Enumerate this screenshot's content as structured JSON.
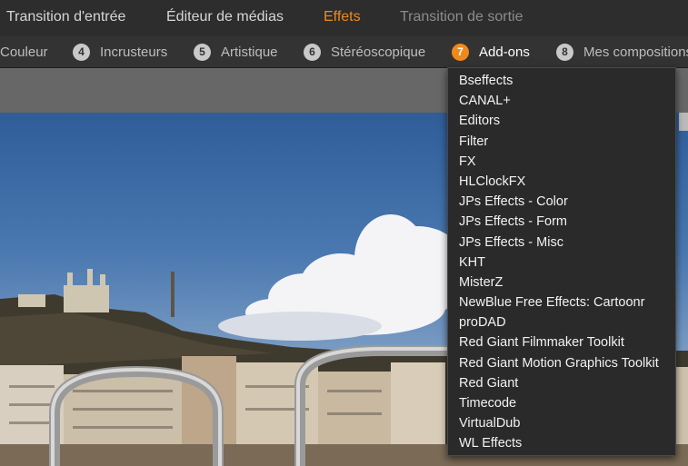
{
  "tabs": [
    {
      "label": "Transition d'entrée",
      "state": "normal"
    },
    {
      "label": "Éditeur de médias",
      "state": "normal"
    },
    {
      "label": "Effets",
      "state": "active"
    },
    {
      "label": "Transition de sortie",
      "state": "dim"
    }
  ],
  "categories": [
    {
      "num": "",
      "label": "Couleur"
    },
    {
      "num": "4",
      "label": "Incrusteurs"
    },
    {
      "num": "5",
      "label": "Artistique"
    },
    {
      "num": "6",
      "label": "Stéréoscopique"
    },
    {
      "num": "7",
      "label": "Add-ons"
    },
    {
      "num": "8",
      "label": "Mes compositions"
    }
  ],
  "addons_menu": {
    "items": [
      "Bseffects",
      "CANAL+",
      "Editors",
      "Filter",
      "FX",
      "HLClockFX",
      "JPs Effects - Color",
      "JPs Effects - Form",
      "JPs Effects - Misc",
      "KHT",
      "MisterZ",
      "NewBlue Free Effects: Cartoonr",
      "proDAD",
      "Red Giant Filmmaker Toolkit",
      "Red Giant Motion Graphics Toolkit",
      "Red Giant",
      "Timecode",
      "VirtualDub",
      "WL Effects"
    ]
  },
  "colors": {
    "accent": "#f0891b",
    "menu_bg": "#2a2a2a",
    "toolbar_bg": "#2d2d2d"
  }
}
